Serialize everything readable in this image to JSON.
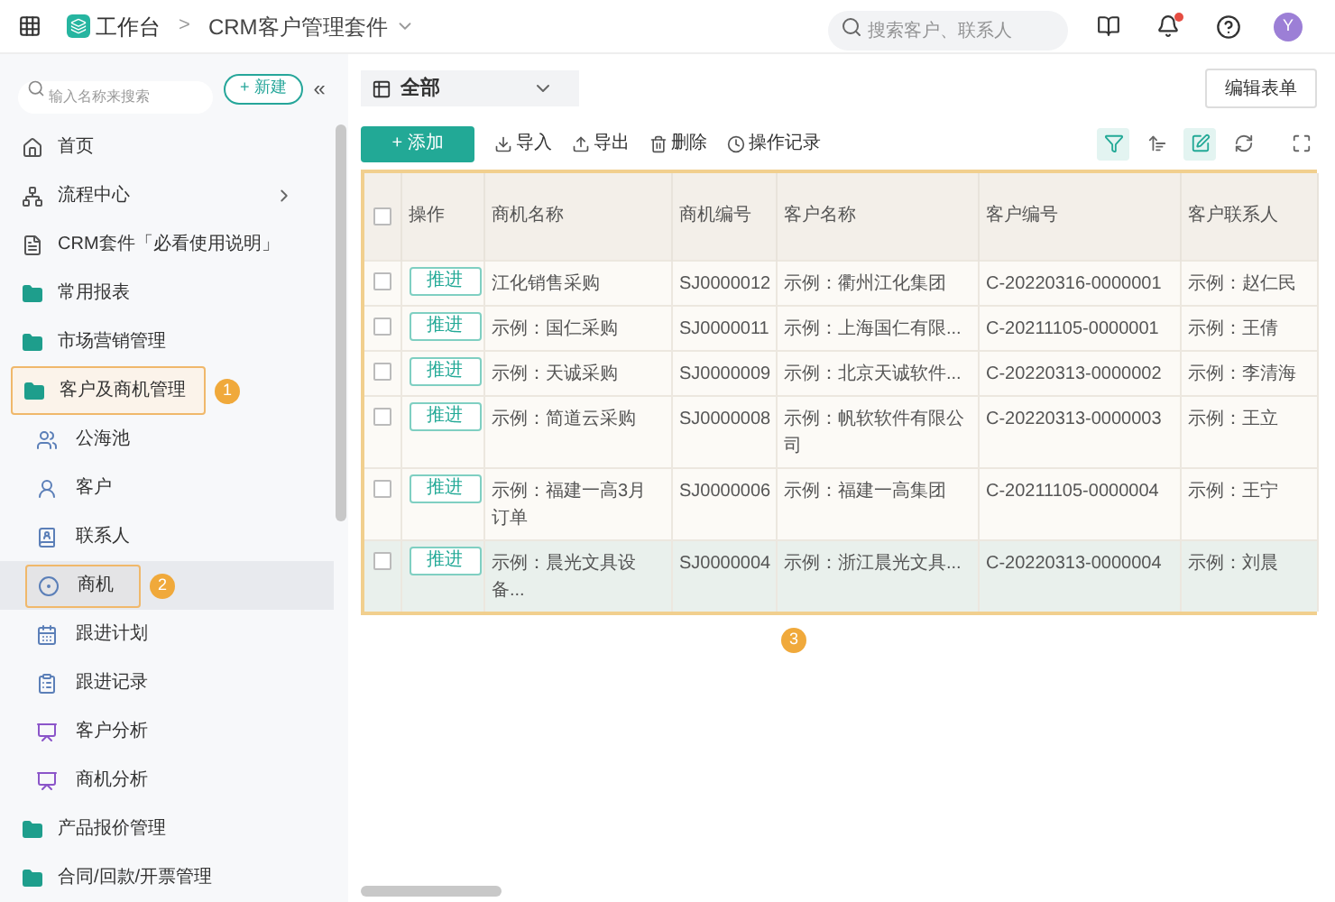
{
  "topbar": {
    "home": "工作台",
    "separator": ">",
    "app": "CRM客户管理套件",
    "search": {
      "placeholder": "搜索客户、联系人"
    },
    "avatar": "Y",
    "notification_dot": true
  },
  "sidebar": {
    "search": {
      "placeholder": "输入名称来搜索"
    },
    "new_button": "+ 新建",
    "collapse": "«",
    "items": [
      {
        "label": "首页",
        "selected": false,
        "expandable": false
      },
      {
        "label": "流程中心",
        "selected": false,
        "expandable": true
      },
      {
        "label": "CRM套件「必看使用说明」",
        "selected": false,
        "expandable": false
      },
      {
        "label": "常用报表",
        "selected": false,
        "expandable": false
      },
      {
        "label": "市场营销管理",
        "selected": false,
        "expandable": false
      },
      {
        "label": "客户及商机管理",
        "selected": false,
        "expandable": false,
        "callout": "1",
        "children": [
          {
            "label": "公海池",
            "selected": false
          },
          {
            "label": "客户",
            "selected": false
          },
          {
            "label": "联系人",
            "selected": false
          },
          {
            "label": "商机",
            "selected": true,
            "callout": "2"
          },
          {
            "label": "跟进计划",
            "selected": false
          },
          {
            "label": "跟进记录",
            "selected": false
          },
          {
            "label": "客户分析",
            "selected": false
          },
          {
            "label": "商机分析",
            "selected": false
          }
        ]
      },
      {
        "label": "产品报价管理",
        "selected": false,
        "expandable": false
      },
      {
        "label": "合同/回款/开票管理",
        "selected": false,
        "expandable": false
      }
    ]
  },
  "view_select": {
    "value": "全部"
  },
  "edit_form_button": "编辑表单",
  "toolbar": {
    "add": "+ 添加",
    "actions": [
      "导入",
      "导出",
      "删除",
      "操作记录"
    ],
    "view_tools": [
      {
        "active": true
      },
      {
        "active": false
      },
      {
        "active": true
      },
      {
        "active": false
      },
      {
        "active": false
      }
    ]
  },
  "table": {
    "callout": "3",
    "header_checked": false,
    "columns": [
      "操作",
      "商机名称",
      "商机编号",
      "客户名称",
      "客户编号",
      "客户联系人"
    ],
    "rows": [
      {
        "checked": false,
        "highlighted": false,
        "cells": [
          "推进",
          "江化销售采购",
          "SJ0000012",
          "示例：衢州江化集团",
          "C-20220316-0000001",
          "示例：赵仁民"
        ]
      },
      {
        "checked": false,
        "highlighted": false,
        "cells": [
          "推进",
          "示例：国仁采购",
          "SJ0000011",
          "示例：上海国仁有限...",
          "C-20211105-0000001",
          "示例：王倩"
        ]
      },
      {
        "checked": false,
        "highlighted": false,
        "cells": [
          "推进",
          "示例：天诚采购",
          "SJ0000009",
          "示例：北京天诚软件...",
          "C-20220313-0000002",
          "示例：李清海"
        ]
      },
      {
        "checked": false,
        "highlighted": false,
        "cells": [
          "推进",
          "示例：简道云采购",
          "SJ0000008",
          "示例：帆软软件有限公司",
          "C-20220313-0000003",
          "示例：王立"
        ]
      },
      {
        "checked": false,
        "highlighted": false,
        "cells": [
          "推进",
          "示例：福建一高3月订单",
          "SJ0000006",
          "示例：福建一高集团",
          "C-20211105-0000004",
          "示例：王宁"
        ]
      },
      {
        "checked": false,
        "highlighted": true,
        "cells": [
          "推进",
          "示例：晨光文具设备...",
          "SJ0000004",
          "示例：浙江晨光文具...",
          "C-20220313-0000004",
          "示例：刘晨"
        ]
      }
    ]
  }
}
